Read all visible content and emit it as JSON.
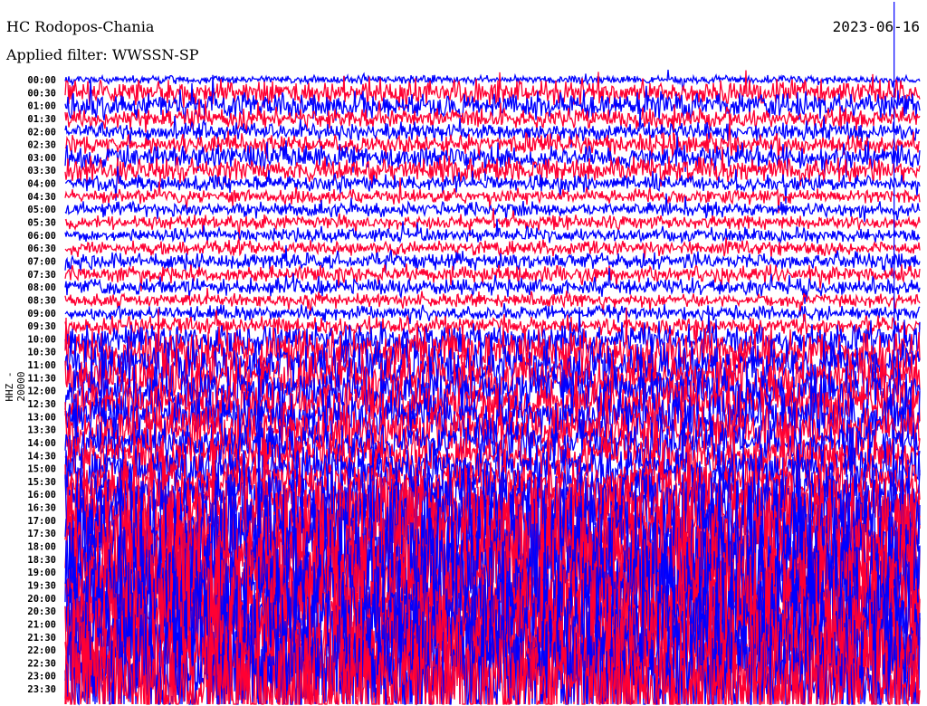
{
  "header": {
    "station": "HC Rodopos-Chania",
    "filter": "Applied filter: WWSSN-SP",
    "date": "2023-06-16",
    "channel": "HHZ - 20000"
  },
  "chart_data": {
    "type": "line",
    "title": "HC Rodopos-Chania",
    "subtitle": "Applied filter: WWSSN-SP",
    "ylabel": "HHZ - 20000",
    "xlabel": "",
    "minutes_per_line": 30,
    "colors": [
      "#0000ff",
      "#ff0033"
    ],
    "row_labels": [
      "00:00",
      "00:30",
      "01:00",
      "01:30",
      "02:00",
      "02:30",
      "03:00",
      "03:30",
      "04:00",
      "04:30",
      "05:00",
      "05:30",
      "06:00",
      "06:30",
      "07:00",
      "07:30",
      "08:00",
      "08:30",
      "09:00",
      "09:30",
      "10:00",
      "10:30",
      "11:00",
      "11:30",
      "12:00",
      "12:30",
      "13:00",
      "13:30",
      "14:00",
      "14:30",
      "15:00",
      "15:30",
      "16:00",
      "16:30",
      "17:00",
      "17:30",
      "18:00",
      "18:30",
      "19:00",
      "19:30",
      "20:00",
      "20:30",
      "21:00",
      "21:30",
      "22:00",
      "22:30",
      "23:00",
      "23:30"
    ],
    "relative_amplitude": [
      0.3,
      0.9,
      0.9,
      0.7,
      0.6,
      0.7,
      0.9,
      0.9,
      0.6,
      0.5,
      0.5,
      0.5,
      0.5,
      0.5,
      0.6,
      0.6,
      0.6,
      0.5,
      0.5,
      0.7,
      1.2,
      1.6,
      1.8,
      1.8,
      1.8,
      1.8,
      1.8,
      1.8,
      1.6,
      1.6,
      1.6,
      1.6,
      2.2,
      2.8,
      3.5,
      4,
      4.5,
      4.5,
      4.5,
      4.5,
      4.5,
      4.5,
      4.5,
      4.5,
      4.5,
      4.5,
      4.5,
      4.5
    ],
    "event_marker_minute": 29.1
  }
}
